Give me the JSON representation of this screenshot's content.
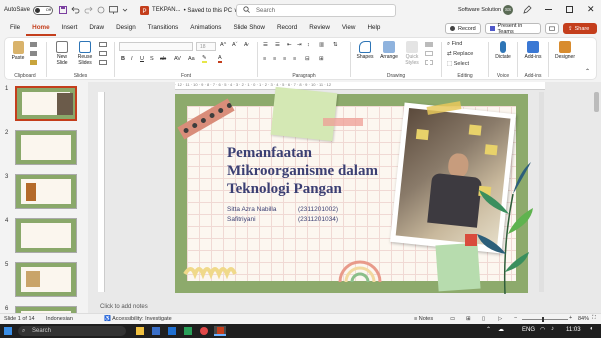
{
  "titlebar": {
    "autosave_label": "AutoSave",
    "autosave_state": "Off",
    "doc_title": "TEKPAN...",
    "saved_status": "• Saved to this PC ∨",
    "search_placeholder": "Search",
    "account_name": "Software Solution",
    "account_initials": "SS"
  },
  "tabs": [
    "File",
    "Home",
    "Insert",
    "Draw",
    "Design",
    "Transitions",
    "Animations",
    "Slide Show",
    "Record",
    "Review",
    "View",
    "Help"
  ],
  "tab_buttons": {
    "record": "Record",
    "present": "Present in Teams",
    "share": "Share"
  },
  "ribbon": {
    "clipboard": {
      "paste": "Paste",
      "label": "Clipboard"
    },
    "slides": {
      "new_slide": "New Slide",
      "reuse_slides": "Reuse Slides",
      "label": "Slides"
    },
    "font": {
      "label": "Font",
      "size": "18"
    },
    "paragraph": {
      "label": "Paragraph"
    },
    "drawing": {
      "shapes": "Shapes",
      "arrange": "Arrange",
      "quick_styles": "Quick Styles",
      "label": "Drawing"
    },
    "editing": {
      "find": "Find",
      "replace": "Replace",
      "select": "Select",
      "label": "Editing"
    },
    "voice": {
      "dictate": "Dictate",
      "label": "Voice"
    },
    "addins": {
      "addins": "Add-ins",
      "label": "Add-ins"
    },
    "designer": {
      "designer": "Designer"
    }
  },
  "thumbnails": [
    {
      "num": "1"
    },
    {
      "num": "2"
    },
    {
      "num": "3"
    },
    {
      "num": "4"
    },
    {
      "num": "5"
    },
    {
      "num": "6"
    }
  ],
  "ruler_h": "· 12 · 11 · 10 · 9 · 8 · 7 · 6 · 5 · 4 · 3 · 2 · 1 · 0 · 1 · 2 · 3 · 4 · 5 · 6 · 7 · 8 · 9 · 10 · 11 · 12",
  "slide": {
    "title_line1": "Pemanfaatan",
    "title_line2": "Mikroorganisme dalam",
    "title_line3": "Teknologi Pangan",
    "author1_name": "Sitta Azra Nabilla",
    "author1_id": "(2311201002)",
    "author2_name": "Safitriyani",
    "author2_id": "(2311201034)"
  },
  "notes_placeholder": "Click to add notes",
  "status": {
    "slide_info": "Slide 1 of 14",
    "language": "Indonesian",
    "accessibility": "Accessibility: Investigate",
    "notes": "Notes",
    "zoom": "84%"
  },
  "taskbar": {
    "search": "Search",
    "lang": "ENG",
    "time": "11:03"
  },
  "colors": {
    "accent": "#c43e1c",
    "slide_green": "#8daa6c",
    "title_text": "#3b3f73"
  }
}
